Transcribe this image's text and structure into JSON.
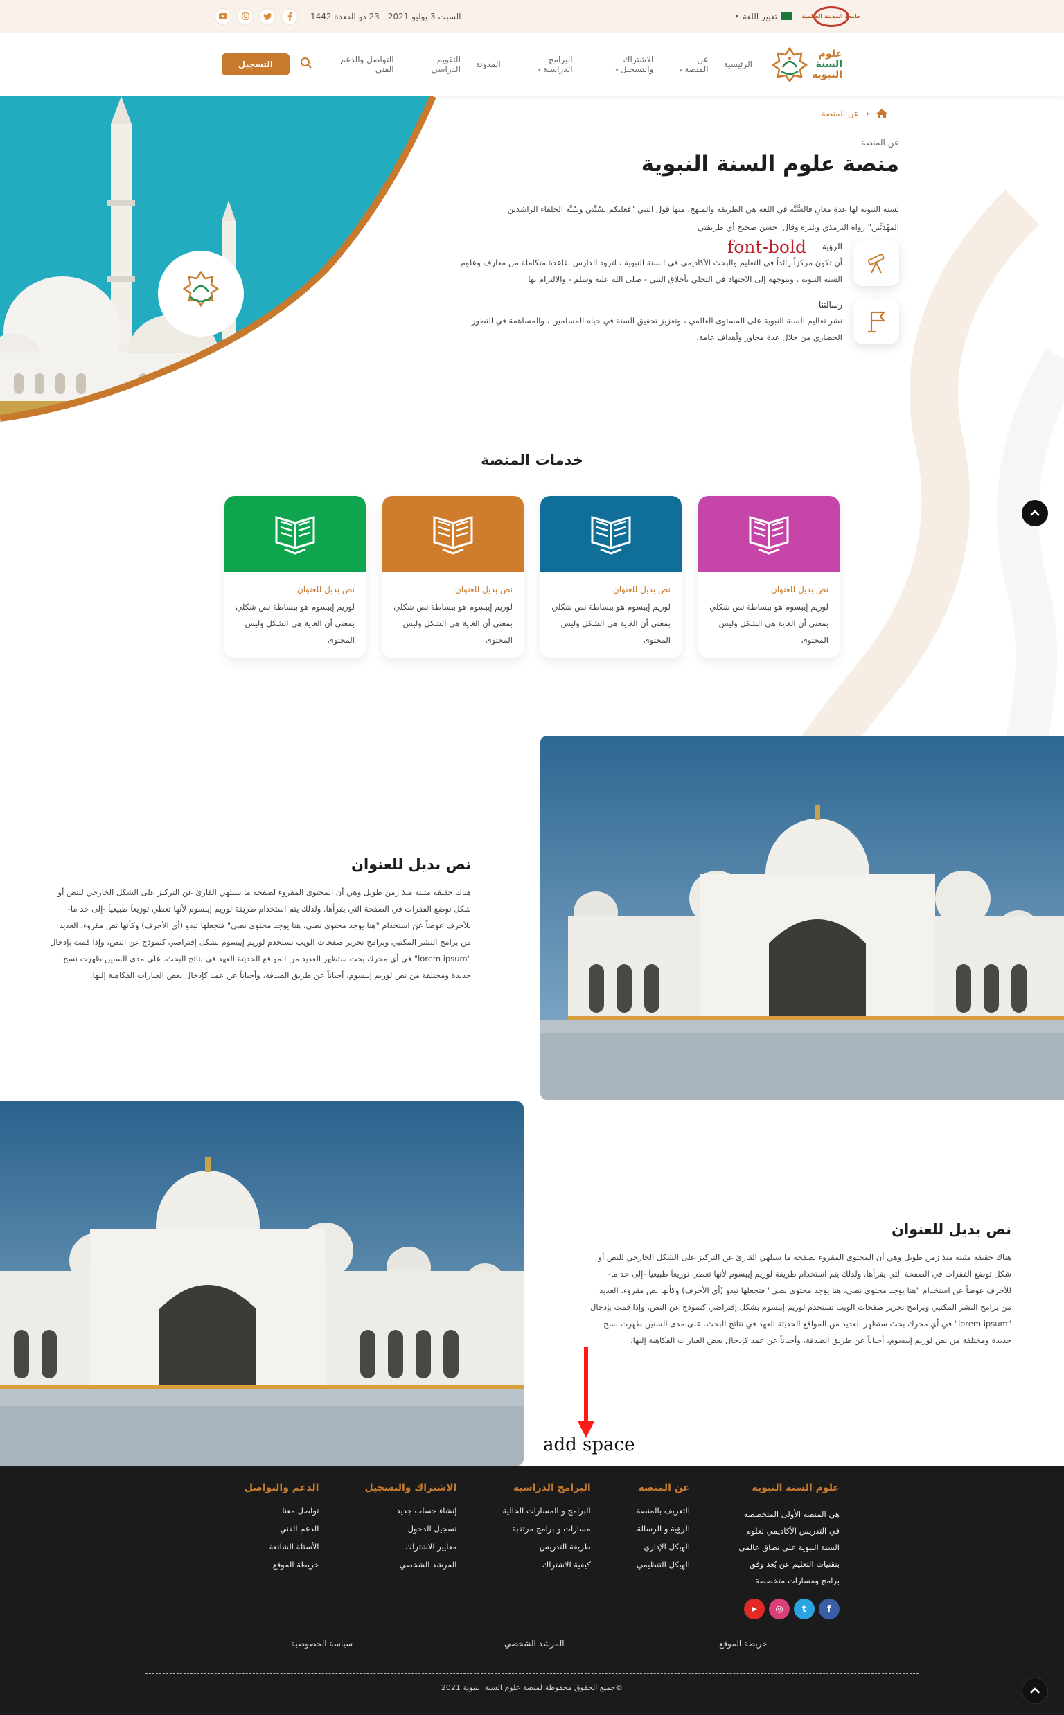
{
  "topbar": {
    "university_logo_text": "جامعة المدينة العالمية",
    "language_label": "تغيير اللغة",
    "date": "السبت 3 يوليو 2021 - 23 ذو القعدة 1442",
    "socials": [
      "youtube",
      "instagram",
      "twitter",
      "facebook"
    ]
  },
  "brand": {
    "logo_words": [
      "علوم",
      "السنة",
      "النبوية"
    ],
    "accent": "#c77a2e",
    "green": "#1f8a4c"
  },
  "nav": {
    "items": [
      {
        "label": "الرئيسية",
        "dropdown": false
      },
      {
        "label": "عن المنصة",
        "dropdown": true
      },
      {
        "label": "الاشتراك والتسجيل",
        "dropdown": true
      },
      {
        "label": "البرامج الدراسية",
        "dropdown": true
      },
      {
        "label": "المدونة",
        "dropdown": false
      },
      {
        "label": "التقويم الدراسي",
        "dropdown": false
      },
      {
        "label": "التواصل والدعم الفني",
        "dropdown": false
      }
    ],
    "register_label": "التسجيل"
  },
  "breadcrumb": {
    "current": "عن المنصة"
  },
  "about": {
    "kicker": "عن المنصة",
    "title": "منصة علوم السنة النبوية",
    "description": "لسنة النبوية لها عدة معانٍ فالسُّنَّة في اللغة هي الطريقة والمنهج، منها قول النبي \"فعليكم بسُنَّتي وسُنَّة الخلفاء الراشدين المَهْديِّين\" رواه الترمذي وغيره وقال: حسن صحيح أي طريقتي",
    "vision_title": "الرؤية",
    "vision_text": "أن تكون مركزاً رائداً في التعليم والبحث الأكاديمي في السنة النبوية ، لتزود الدارس بقاعدة متكاملة من معارف وعلوم السنة النبوية ، وبتوجهه إلى الاجتهاد في التحلي بأخلاق النبي - صلى الله عليه وسلم - والالتزام بها",
    "mission_title": "رسالتنا",
    "mission_text": "نشر تعاليم السنة النبوية على المستوى العالمي ، وتعزيز تحقيق السنة في حياه المسلمين ، والمساهمة في التطور الحضاري من خلال عدة محاور وأهداف عامة."
  },
  "annotations": {
    "font_bold": "font-bold",
    "add_space": "add space"
  },
  "services": {
    "title": "خدمات المنصة",
    "cards": [
      {
        "title": "نص بديل للعنوان",
        "text": "لوريم إيبسوم هو ببساطة نص شكلي بمعنى أن الغاية هي الشكل وليس المحتوى",
        "color": "#c545a8"
      },
      {
        "title": "نص بديل للعنوان",
        "text": "لوريم إيبسوم هو ببساطة نص شكلي بمعنى أن الغاية هي الشكل وليس المحتوى",
        "color": "#0f6f99"
      },
      {
        "title": "نص بديل للعنوان",
        "text": "لوريم إيبسوم هو ببساطة نص شكلي بمعنى أن الغاية هي الشكل وليس المحتوى",
        "color": "#cf7c2c"
      },
      {
        "title": "نص بديل للعنوان",
        "text": "لوريم إيبسوم هو ببساطة نص شكلي بمعنى أن الغاية هي الشكل وليس المحتوى",
        "color": "#0fa54e"
      }
    ]
  },
  "content_rows": [
    {
      "title": "نص بديل للعنوان",
      "text": "هناك حقيقة مثبتة منذ زمن طويل وهي أن المحتوى المقروء لصفحة ما سيلهي القارئ عن التركيز على الشكل الخارجي للنص أو شكل توضع الفقرات في الصفحة التي يقرأها. ولذلك يتم استخدام طريقة لوريم إيبسوم لأنها تعطي توزيعاَ طبيعياَ -إلى حد ما- للأحرف عوضاً عن استخدام \"هنا يوجد محتوى نصي، هنا يوجد محتوى نصي\" فتجعلها تبدو (أي الأحرف) وكأنها نص مقروء. العديد من برامح النشر المكتبي وبرامح تحرير صفحات الويب تستخدم لوريم إيبسوم بشكل إفتراضي كنموذج عن النص، وإذا قمت بإدخال \"lorem ipsum\" في أي محرك بحث ستظهر العديد من المواقع الحديثة العهد في نتائج البحث. على مدى السنين ظهرت نسخ جديدة ومختلفة من نص لوريم إيبسوم، أحياناً عن طريق الصدفة، وأحياناً عن عمد كإدخال بعض العبارات الفكاهية إليها."
    },
    {
      "title": "نص بديل للعنوان",
      "text": "هناك حقيقة مثبتة منذ زمن طويل وهي أن المحتوى المقروء لصفحة ما سيلهي القارئ عن التركيز على الشكل الخارجي للنص أو شكل توضع الفقرات في الصفحة التي يقرأها. ولذلك يتم استخدام طريقة لوريم إيبسوم لأنها تعطي توزيعاَ طبيعياَ -إلى حد ما- للأحرف عوضاً عن استخدام \"هنا يوجد محتوى نصي، هنا يوجد محتوى نصي\" فتجعلها تبدو (أي الأحرف) وكأنها نص مقروء. العديد من برامح النشر المكتبي وبرامح تحرير صفحات الويب تستخدم لوريم إيبسوم بشكل إفتراضي كنموذج عن النص، وإذا قمت بإدخال \"lorem ipsum\" في أي محرك بحث ستظهر العديد من المواقع الحديثة العهد في نتائج البحث. على مدى السنين ظهرت نسخ جديدة ومختلفة من نص لوريم إيبسوم، أحياناً عن طريق الصدفة، وأحياناً عن عمد كإدخال بعض العبارات الفكاهية إليها."
    }
  ],
  "footer": {
    "brand_title": "علوم السنة النبوية",
    "brand_text": "هي المنصة الأولى المتخصصة في التدريس الأكاديمي لعلوم السنة النبوية على نطاق عالمي بتقنيات التعليم عن بُعد وفق برامج ومسارات متخصصة",
    "columns": [
      {
        "title": "عن المنصة",
        "items": [
          "التعريف بالمنصة",
          "الرؤية و الرسالة",
          "الهيكل الإداري",
          "الهيكل التنظيمي"
        ]
      },
      {
        "title": "البرامج الدراسية",
        "items": [
          "البرامج و المسارات الحالية",
          "مسارات و برامج مرتقبة",
          "طريقة التدريس",
          "كيفية الاشتراك"
        ]
      },
      {
        "title": "الاشتراك والتسجيل",
        "items": [
          "إنشاء حساب جديد",
          "تسجيل الدخول",
          "معايير الاشتراك",
          "المرشد الشخصي"
        ]
      },
      {
        "title": "الدعم والتواصل",
        "items": [
          "تواصل معنا",
          "الدعم الفني",
          "الأسئلة الشائعة",
          "خريطة الموقع"
        ]
      }
    ],
    "socials": [
      {
        "name": "facebook",
        "glyph": "f",
        "color": "#3b5ea8"
      },
      {
        "name": "twitter",
        "glyph": "t",
        "color": "#2aa3e3"
      },
      {
        "name": "instagram",
        "glyph": "◎",
        "color": "#d8407a"
      },
      {
        "name": "youtube",
        "glyph": "▶",
        "color": "#e12a26"
      }
    ],
    "bottom_links": [
      "خريطة الموقع",
      "المرشد الشخصي",
      "سياسة الخصوصية"
    ],
    "copyright": "©جميع الحقوق محفوظة لمنصة علوم السنة النبوية 2021"
  }
}
